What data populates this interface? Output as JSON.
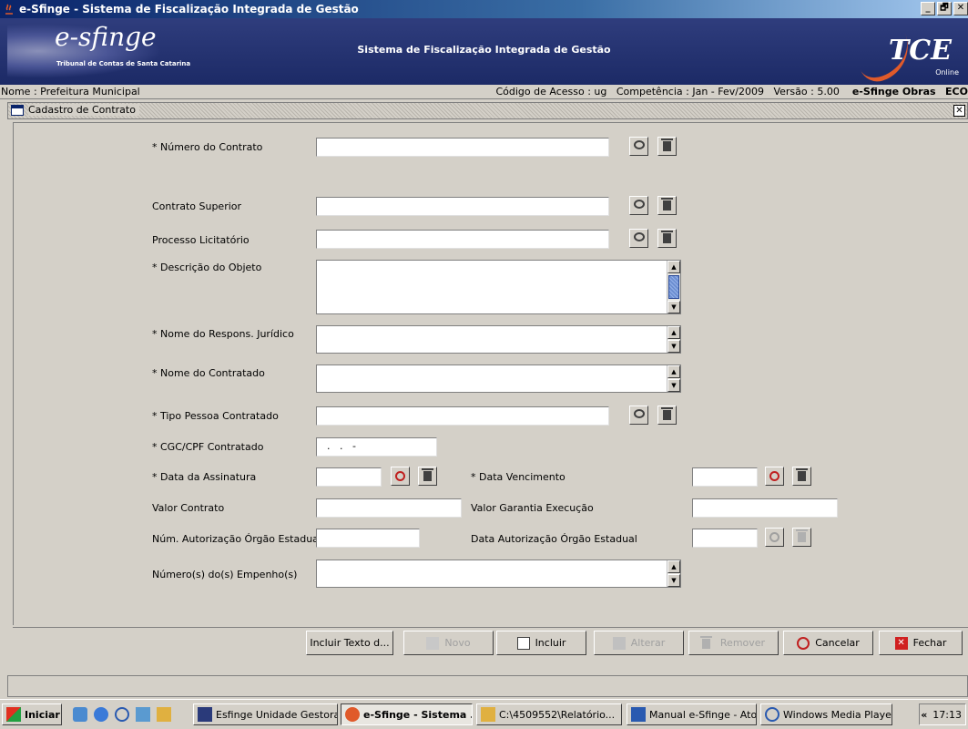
{
  "window": {
    "title": "e-Sfinge - Sistema de Fiscalização Integrada de Gestão",
    "min": "_",
    "max": "🗗",
    "close": "✕"
  },
  "banner": {
    "logo": "e-sfinge",
    "logo_sub": "Tribunal de Contas de Santa Catarina",
    "title": "Sistema de Fiscalização Integrada de Gestão",
    "tce": "TCE",
    "tce_sub": "Online"
  },
  "infobar": {
    "nome": "Nome : Prefeitura Municipal",
    "codigo": "Código de Acesso : ug",
    "competencia": "Competência : Jan - Fev/2009",
    "versao": "Versão : 5.00",
    "modulo": "e-Sfinge Obras",
    "extra": "ECO"
  },
  "frame": {
    "title": "Cadastro de Contrato",
    "close": "✕"
  },
  "form": {
    "numero_contrato": "* Número do Contrato",
    "contrato_superior": "Contrato Superior",
    "processo_licitatorio": "Processo Licitatório",
    "descricao_objeto": "* Descrição do Objeto",
    "nome_respons_juridico": "* Nome do Respons. Jurídico",
    "nome_contratado": "* Nome do Contratado",
    "tipo_pessoa": "* Tipo Pessoa Contratado",
    "cgc_cpf": "* CGC/CPF Contratado",
    "cgc_cpf_value": "  .   .   -",
    "data_assinatura": "* Data da Assinatura",
    "data_vencimento": "* Data Vencimento",
    "valor_contrato": "Valor Contrato",
    "valor_garantia": "Valor Garantia Execução",
    "num_autorizacao": "Núm. Autorização Órgão Estadual",
    "data_autorizacao": "Data Autorização Órgão Estadual",
    "empenhos": "Número(s) do(s) Empenho(s)"
  },
  "buttons": {
    "incluir_texto": "Incluir Texto d...",
    "novo": "Novo",
    "incluir": "Incluir",
    "alterar": "Alterar",
    "remover": "Remover",
    "cancelar": "Cancelar",
    "fechar": "Fechar"
  },
  "taskbar": {
    "start": "Iniciar",
    "items": [
      "Esfinge Unidade Gestora",
      "e-Sfinge - Sistema ...",
      "C:\\4509552\\Relatório...",
      "Manual e-Sfinge - Ato...",
      "Windows Media Player"
    ],
    "tray_arrows": "«",
    "clock": "17:13"
  },
  "colors": {
    "titlebar": "#0a246a",
    "banner": "#1c2a66",
    "window_bg": "#d4d0c8",
    "accent_orange": "#e05a2a",
    "cancel_red": "#c02020"
  }
}
